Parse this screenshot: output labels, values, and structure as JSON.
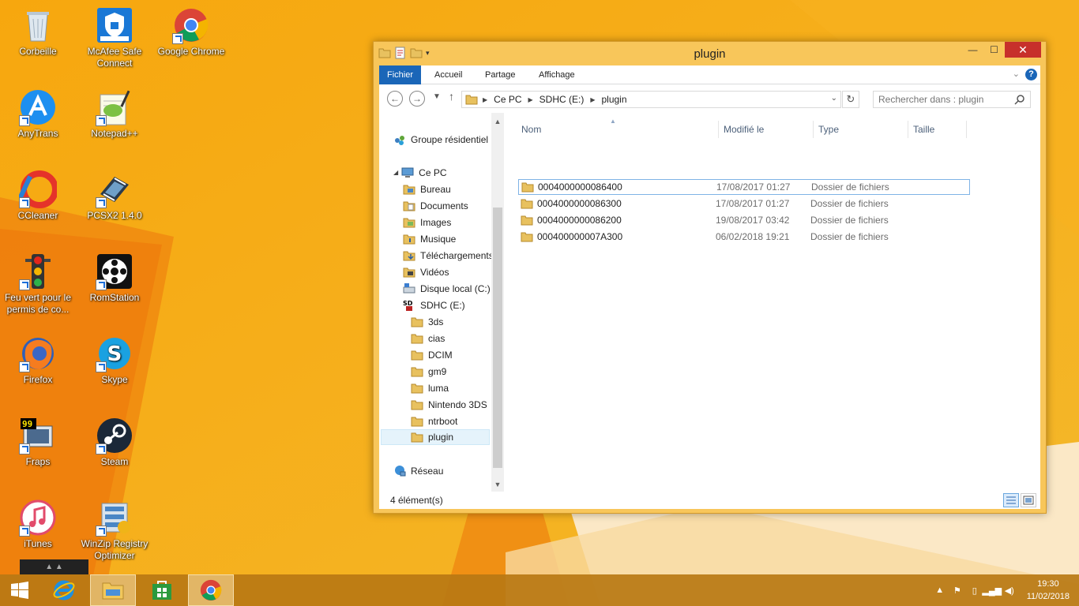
{
  "desktop": {
    "icons": [
      {
        "label": "Corbeille",
        "icon": "recycle-bin-icon"
      },
      {
        "label": "McAfee Safe Connect",
        "icon": "mcafee-icon"
      },
      {
        "label": "Google Chrome",
        "icon": "chrome-icon"
      },
      {
        "label": "AnyTrans",
        "icon": "anytrans-icon"
      },
      {
        "label": "Notepad++",
        "icon": "notepadpp-icon"
      },
      {
        "label": "CCleaner",
        "icon": "ccleaner-icon"
      },
      {
        "label": "PCSX2 1.4.0",
        "icon": "pcsx2-icon"
      },
      {
        "label": "Feu vert pour le permis de co...",
        "icon": "traffic-light-icon"
      },
      {
        "label": "RomStation",
        "icon": "romstation-icon"
      },
      {
        "label": "Firefox",
        "icon": "firefox-icon"
      },
      {
        "label": "Skype",
        "icon": "skype-icon"
      },
      {
        "label": "Fraps",
        "icon": "fraps-icon"
      },
      {
        "label": "Steam",
        "icon": "steam-icon"
      },
      {
        "label": "iTunes",
        "icon": "itunes-icon"
      },
      {
        "label": "WinZip Registry Optimizer",
        "icon": "winzip-icon"
      }
    ]
  },
  "window": {
    "title": "plugin",
    "ribbon_tabs": [
      "Fichier",
      "Accueil",
      "Partage",
      "Affichage"
    ],
    "address": [
      "Ce PC",
      "SDHC (E:)",
      "plugin"
    ],
    "search_placeholder": "Rechercher dans : plugin",
    "nav": {
      "homegroup": "Groupe résidentiel",
      "this_pc": "Ce PC",
      "items": [
        {
          "label": "Bureau",
          "icon": "folder-icon"
        },
        {
          "label": "Documents",
          "icon": "folder-icon"
        },
        {
          "label": "Images",
          "icon": "folder-icon"
        },
        {
          "label": "Musique",
          "icon": "folder-icon"
        },
        {
          "label": "Téléchargements",
          "icon": "folder-icon"
        },
        {
          "label": "Vidéos",
          "icon": "folder-icon"
        },
        {
          "label": "Disque local (C:)",
          "icon": "drive-icon"
        },
        {
          "label": "SDHC (E:)",
          "icon": "sd-card-icon"
        }
      ],
      "sd_folders": [
        "3ds",
        "cias",
        "DCIM",
        "gm9",
        "luma",
        "Nintendo 3DS",
        "ntrboot",
        "plugin"
      ],
      "network": "Réseau"
    },
    "columns": [
      "Nom",
      "Modifié le",
      "Type",
      "Taille"
    ],
    "files": [
      {
        "name": "0004000000086400",
        "date": "17/08/2017 01:27",
        "type": "Dossier de fichiers"
      },
      {
        "name": "0004000000086300",
        "date": "17/08/2017 01:27",
        "type": "Dossier de fichiers"
      },
      {
        "name": "0004000000086200",
        "date": "19/08/2017 03:42",
        "type": "Dossier de fichiers"
      },
      {
        "name": "000400000007A300",
        "date": "06/02/2018 19:21",
        "type": "Dossier de fichiers"
      }
    ],
    "status": "4 élément(s)"
  },
  "taskbar": {
    "clock_time": "19:30",
    "clock_date": "11/02/2018"
  },
  "colors": {
    "wallpaper": "#f4a10c",
    "window_frame": "#f8c65a",
    "ribbon_file_tab": "#1a66b8",
    "taskbar": "#b97814",
    "close_button": "#c7302b"
  }
}
